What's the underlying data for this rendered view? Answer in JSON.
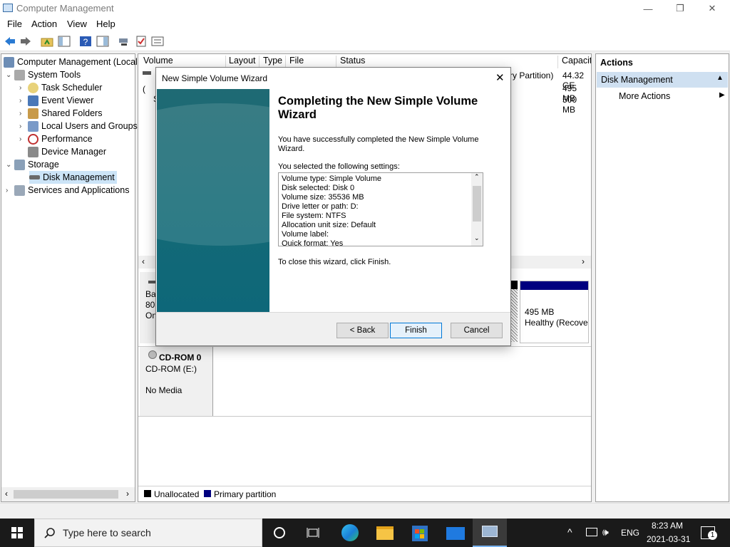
{
  "window": {
    "title": "Computer Management",
    "min": "—",
    "max": "❐",
    "close": "✕"
  },
  "menu": [
    "File",
    "Action",
    "View",
    "Help"
  ],
  "tree": {
    "root": "Computer Management (Local",
    "system_tools": "System Tools",
    "task_scheduler": "Task Scheduler",
    "event_viewer": "Event Viewer",
    "shared_folders": "Shared Folders",
    "local_users": "Local Users and Groups",
    "performance": "Performance",
    "device_manager": "Device Manager",
    "storage": "Storage",
    "disk_management": "Disk Management",
    "services": "Services and Applications"
  },
  "volume_list": {
    "columns": [
      "Volume",
      "Layout",
      "Type",
      "File System",
      "Status",
      "Capacit"
    ],
    "status_fragment": "ry Partition)",
    "capacities": [
      "44.32 GE",
      "495 MB",
      "500 MB"
    ],
    "row_prefix": [
      "",
      "(",
      "S"
    ]
  },
  "disk_view": {
    "disk0_label_fragment": [
      "Ba",
      "80.",
      "On"
    ],
    "recovery_size": "495 MB",
    "recovery_status": "Healthy (Recove",
    "cdrom_title": "CD-ROM 0",
    "cdrom_drive": "CD-ROM (E:)",
    "cdrom_media": "No Media",
    "legend": {
      "unallocated": "Unallocated",
      "primary": "Primary partition"
    },
    "colors": {
      "unallocated": "#000000",
      "primary": "#00007f"
    }
  },
  "actions": {
    "header": "Actions",
    "section": "Disk Management",
    "more": "More Actions"
  },
  "dialog": {
    "title": "New Simple Volume Wizard",
    "heading": "Completing the New Simple Volume Wizard",
    "intro": "You have successfully completed the New Simple Volume Wizard.",
    "settings_label": "You selected the following settings:",
    "settings": [
      "Volume type: Simple Volume",
      "Disk selected: Disk 0",
      "Volume size: 35536 MB",
      "Drive letter or path: D:",
      "File system: NTFS",
      "Allocation unit size: Default",
      "Volume label:",
      "Quick format: Yes"
    ],
    "close_hint": "To close this wizard, click Finish.",
    "buttons": {
      "back": "< Back",
      "finish": "Finish",
      "cancel": "Cancel"
    }
  },
  "taskbar": {
    "search_placeholder": "Type here to search",
    "language": "ENG",
    "time": "8:23 AM",
    "date": "2021-03-31",
    "notifications": "1"
  }
}
